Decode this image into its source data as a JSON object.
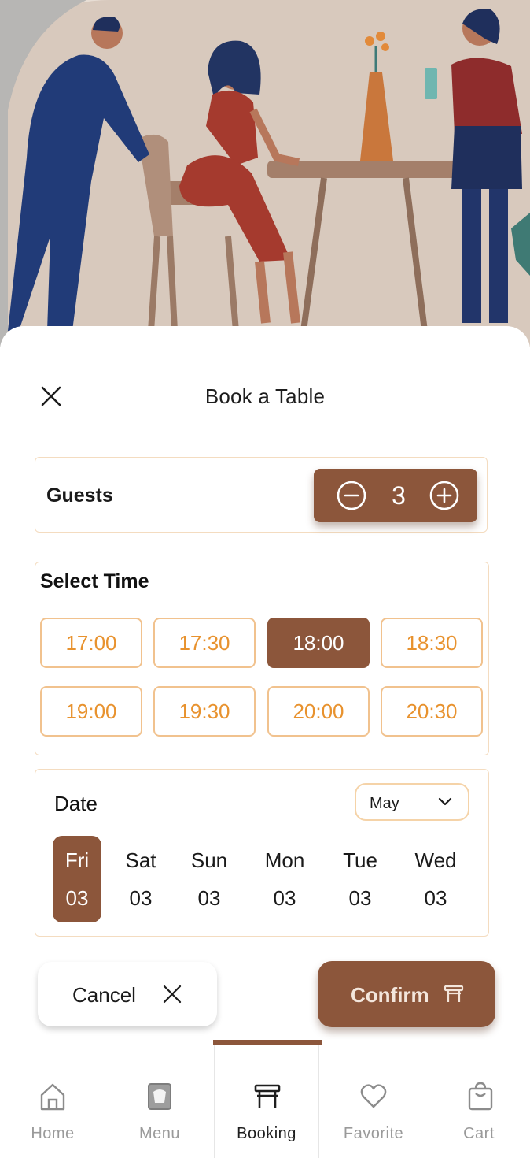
{
  "header": {
    "title": "Book a Table"
  },
  "guests": {
    "label": "Guests",
    "count": "3"
  },
  "time": {
    "label": "Select Time",
    "slots": [
      "17:00",
      "17:30",
      "18:00",
      "18:30",
      "19:00",
      "19:30",
      "20:00",
      "20:30"
    ],
    "selected": "18:00"
  },
  "date": {
    "label": "Date",
    "month": "May",
    "days": [
      {
        "name": "Fri",
        "num": "03"
      },
      {
        "name": "Sat",
        "num": "03"
      },
      {
        "name": "Sun",
        "num": "03"
      },
      {
        "name": "Mon",
        "num": "03"
      },
      {
        "name": "Tue",
        "num": "03"
      },
      {
        "name": "Wed",
        "num": "03"
      }
    ],
    "selected": "Fri"
  },
  "actions": {
    "cancel_label": "Cancel",
    "confirm_label": "Confirm"
  },
  "nav": {
    "items": [
      {
        "label": "Home",
        "icon": "home-icon"
      },
      {
        "label": "Menu",
        "icon": "menu-book-icon"
      },
      {
        "label": "Booking",
        "icon": "table-icon"
      },
      {
        "label": "Favorite",
        "icon": "heart-icon"
      },
      {
        "label": "Cart",
        "icon": "shopping-bag-icon"
      }
    ],
    "active": "Booking"
  },
  "colors": {
    "accent": "#8c563b",
    "slot_text": "#e8922e",
    "slot_border": "#f1c28e",
    "card_border": "#f4dcc0"
  }
}
